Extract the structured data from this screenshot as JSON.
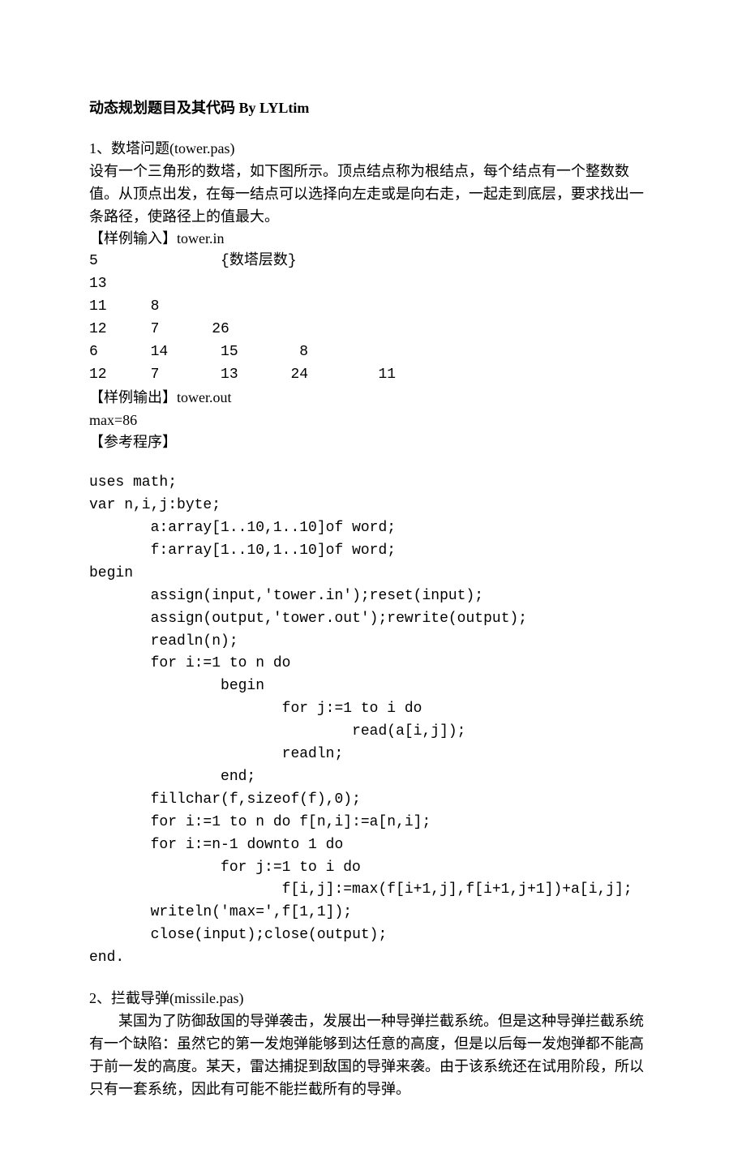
{
  "title": "动态规划题目及其代码 By LYLtim",
  "section1": {
    "heading": "1、数塔问题(tower.pas)",
    "desc": "设有一个三角形的数塔，如下图所示。顶点结点称为根结点，每个结点有一个整数数值。从顶点出发，在每一结点可以选择向左走或是向右走，一起走到底层，要求找出一条路径，使路径上的值最大。",
    "sample_in_label": "【样例输入】tower.in",
    "sample_in": "5              {数塔层数}\n13\n11     8\n12     7      26\n6      14      15       8\n12     7       13      24        11",
    "sample_out_label": "【样例输出】tower.out",
    "sample_out": "max=86",
    "ref_label": "【参考程序】",
    "code": "uses math;\nvar n,i,j:byte;\n       a:array[1..10,1..10]of word;\n       f:array[1..10,1..10]of word;\nbegin\n       assign(input,'tower.in');reset(input);\n       assign(output,'tower.out');rewrite(output);\n       readln(n);\n       for i:=1 to n do\n               begin\n                      for j:=1 to i do\n                              read(a[i,j]);\n                      readln;\n               end;\n       fillchar(f,sizeof(f),0);\n       for i:=1 to n do f[n,i]:=a[n,i];\n       for i:=n-1 downto 1 do\n               for j:=1 to i do\n                      f[i,j]:=max(f[i+1,j],f[i+1,j+1])+a[i,j];\n       writeln('max=',f[1,1]);\n       close(input);close(output);\nend."
  },
  "section2": {
    "heading": "2、拦截导弹(missile.pas)",
    "para": "某国为了防御敌国的导弹袭击，发展出一种导弹拦截系统。但是这种导弹拦截系统有一个缺陷：虽然它的第一发炮弹能够到达任意的高度，但是以后每一发炮弹都不能高于前一发的高度。某天，雷达捕捉到敌国的导弹来袭。由于该系统还在试用阶段，所以只有一套系统，因此有可能不能拦截所有的导弹。"
  }
}
